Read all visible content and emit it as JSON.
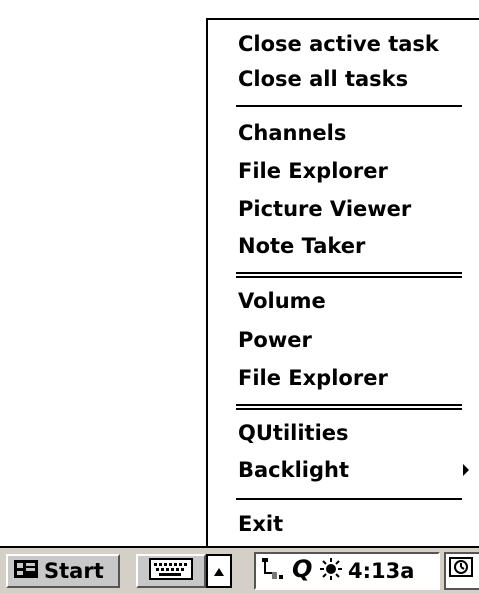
{
  "menu": {
    "items": [
      {
        "label": "Close active task"
      },
      {
        "label": "Close all tasks"
      },
      {
        "label": "Channels"
      },
      {
        "label": "File Explorer"
      },
      {
        "label": "Picture Viewer"
      },
      {
        "label": "Note Taker"
      },
      {
        "label": "Volume"
      },
      {
        "label": "Power"
      },
      {
        "label": "File Explorer"
      },
      {
        "label": "QUtilities"
      },
      {
        "label": "Backlight",
        "has_submenu": true
      },
      {
        "label": "Exit"
      }
    ]
  },
  "taskbar": {
    "start_label": "Start",
    "clock": "4:13a",
    "icons": [
      "start-logo-icon",
      "keyboard-icon",
      "up-arrow-icon",
      "connection-icon",
      "q-app-icon",
      "sun-icon",
      "desktop-icon"
    ]
  }
}
